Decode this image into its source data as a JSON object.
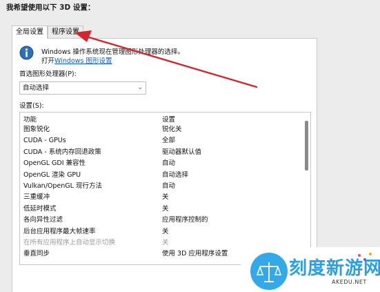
{
  "page": {
    "heading": "我希望使用以下 3D 设置："
  },
  "tabs": [
    {
      "label": "全局设置",
      "active": true
    },
    {
      "label": "程序设置",
      "active": false
    }
  ],
  "info": {
    "icon": "info-icon",
    "line1": "Windows 操作系统现在管理图形处理器的选择。",
    "line2_prefix": "打开",
    "link": "Windows 图形设置"
  },
  "preferred_processor": {
    "label": "首选图形处理器(P):",
    "value": "自动选择"
  },
  "settings": {
    "label": "设置(S):",
    "columns": [
      "功能",
      "设置"
    ],
    "rows": [
      {
        "feature": "图象锐化",
        "value": "锐化关",
        "disabled": false
      },
      {
        "feature": "CUDA - GPUs",
        "value": "全部",
        "disabled": false
      },
      {
        "feature": "CUDA - 系统内存回退政策",
        "value": "驱动器默认值",
        "disabled": false
      },
      {
        "feature": "OpenGL GDI 兼容性",
        "value": "自动",
        "disabled": false
      },
      {
        "feature": "OpenGL 渲染 GPU",
        "value": "自动选择",
        "disabled": false
      },
      {
        "feature": "Vulkan/OpenGL 现行方法",
        "value": "自动",
        "disabled": false
      },
      {
        "feature": "三重缓冲",
        "value": "关",
        "disabled": false
      },
      {
        "feature": "低延时模式",
        "value": "关",
        "disabled": false
      },
      {
        "feature": "各向异性过滤",
        "value": "应用程序控制的",
        "disabled": false
      },
      {
        "feature": "后台应用程序最大帧速率",
        "value": "关",
        "disabled": false
      },
      {
        "feature": "在所有应用程序上自动显示切换",
        "value": "关",
        "disabled": true
      },
      {
        "feature": "垂直同步",
        "value": "使用 3D 应用程序设置",
        "disabled": false
      }
    ]
  },
  "watermark": {
    "title": "刻度新游网",
    "site": "AKEDU.NET"
  },
  "colors": {
    "arrow": "#d0262c",
    "link": "#0b5fc5",
    "watermark": "#2b9fe4"
  }
}
